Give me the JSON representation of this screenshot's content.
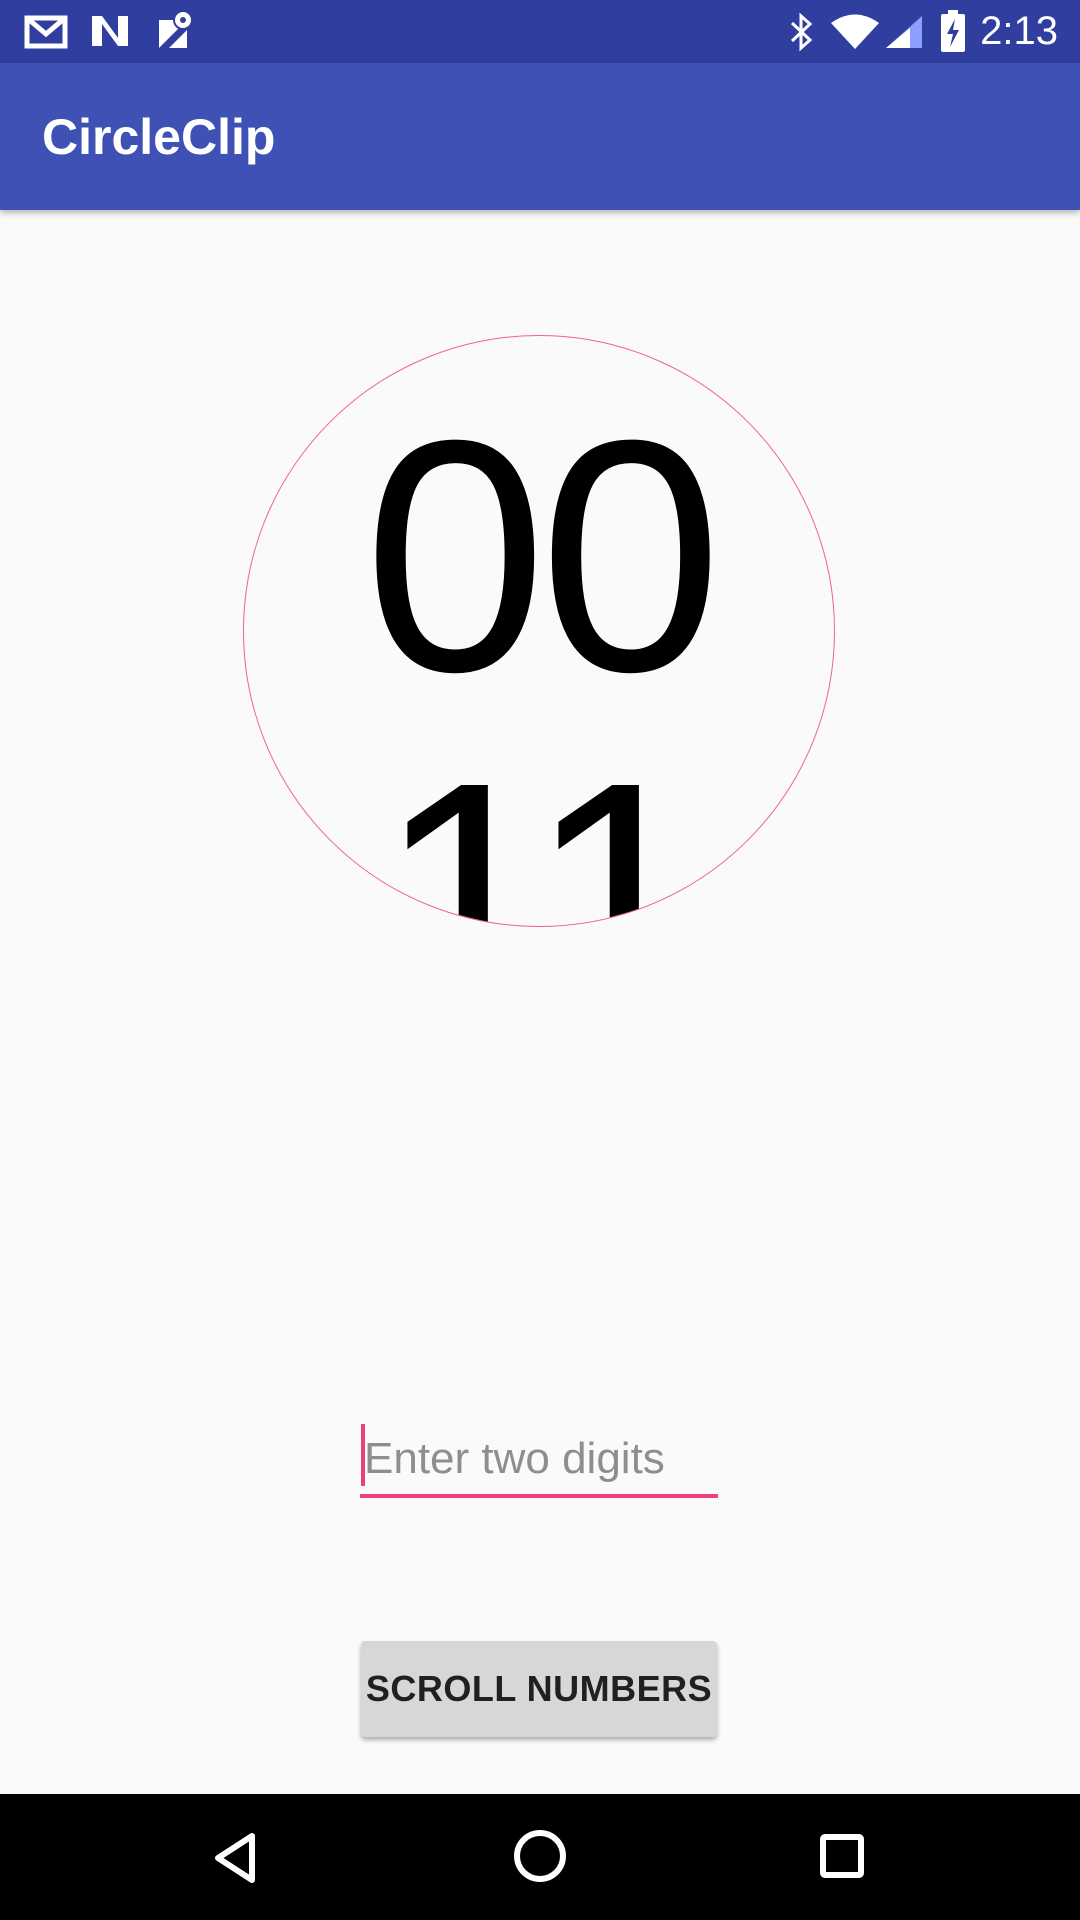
{
  "status_bar": {
    "time": "2:13",
    "icons": [
      "gmail-icon",
      "notification-n-icon",
      "maps-icon",
      "bluetooth-icon",
      "wifi-icon",
      "cellular-signal-icon",
      "battery-charging-icon"
    ],
    "background": "#303f9f"
  },
  "app_bar": {
    "title": "CircleClip",
    "background": "#3f51b5"
  },
  "clip_view": {
    "top_number": "00",
    "bottom_number": "11",
    "circle_color": "#f06292"
  },
  "digits_input": {
    "placeholder": "Enter two digits",
    "value": "",
    "accent": "#ec407a"
  },
  "scroll_button": {
    "label": "SCROLL NUMBERS"
  },
  "nav_bar": {
    "icons": [
      "back-icon",
      "home-icon",
      "recents-icon"
    ]
  }
}
